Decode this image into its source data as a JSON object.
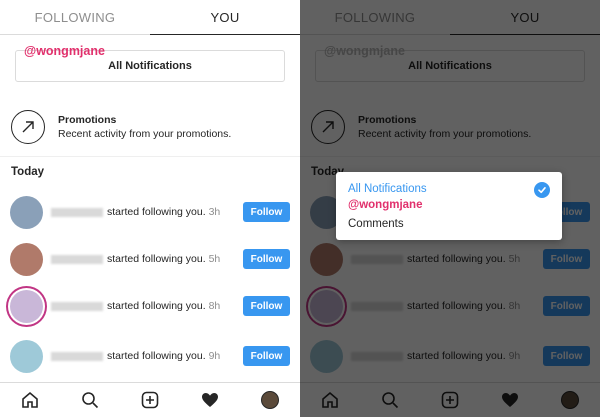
{
  "tabs": [
    {
      "label": "FOLLOWING",
      "active": false
    },
    {
      "label": "YOU",
      "active": true
    }
  ],
  "filter_overlay": {
    "handle": "@wongmjane",
    "button_label": "All Notifications"
  },
  "promotions": {
    "title": "Promotions",
    "subtitle": "Recent activity from your promotions."
  },
  "section_title": "Today",
  "notifications": [
    {
      "text": "started following you.",
      "time": "3h",
      "button": "Follow",
      "avatar_color": "#8aa0b8"
    },
    {
      "text": "started following you.",
      "time": "5h",
      "button": "Follow",
      "avatar_color": "#b07a6a"
    },
    {
      "text": "started following you.",
      "time": "8h",
      "button": "Follow",
      "avatar_color": "#c9b7d8"
    },
    {
      "text": "started following you.",
      "time": "9h",
      "button": "Follow",
      "avatar_color": "#9ec9d8"
    }
  ],
  "nav": {
    "items": [
      "home-icon",
      "search-icon",
      "add-icon",
      "heart-icon",
      "profile-avatar"
    ]
  },
  "popup": {
    "options": [
      "All Notifications",
      "@wongmjane",
      "Comments"
    ],
    "selected": "All Notifications"
  },
  "colors": {
    "accent": "#3897f0",
    "pink": "#e1306c",
    "text": "#262626",
    "muted": "#8e8e8e"
  }
}
